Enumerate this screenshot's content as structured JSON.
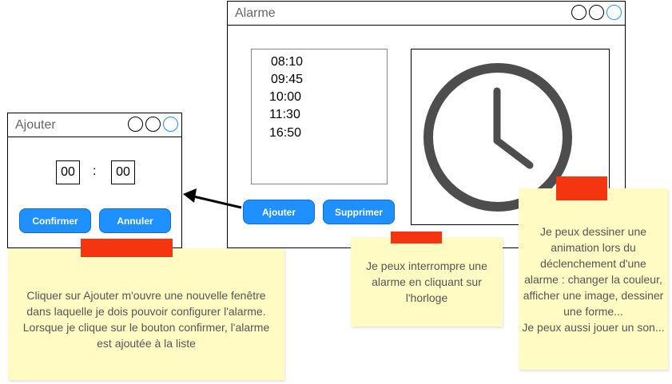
{
  "alarm_window": {
    "title": "Alarme",
    "alarms": [
      "08:10",
      "09:45",
      "10:00",
      "11:30",
      "16:50"
    ],
    "add_label": "Ajouter",
    "delete_label": "Supprimer"
  },
  "add_window": {
    "title": "Ajouter",
    "hours": "00",
    "separator": ":",
    "minutes": "00",
    "confirm_label": "Confirmer",
    "cancel_label": "Annuler"
  },
  "notes": {
    "add_note": "Cliquer sur Ajouter m'ouvre une nouvelle fenêtre dans laquelle je dois pouvoir configurer l'alarme. Lorsque je clique sur le bouton confirmer, l'alarme est ajoutée à la liste",
    "clock_note": "Je peux interrompre une alarme en cliquant sur l'horloge",
    "animation_note": "Je peux dessiner une animation lors du déclenchement d'une alarme : changer la couleur, afficher une image, dessiner une forme...\nJe peux aussi jouer un son..."
  },
  "colors": {
    "accent": "#1e90ff",
    "note": "#fffbc3",
    "tape": "#f5350f"
  }
}
